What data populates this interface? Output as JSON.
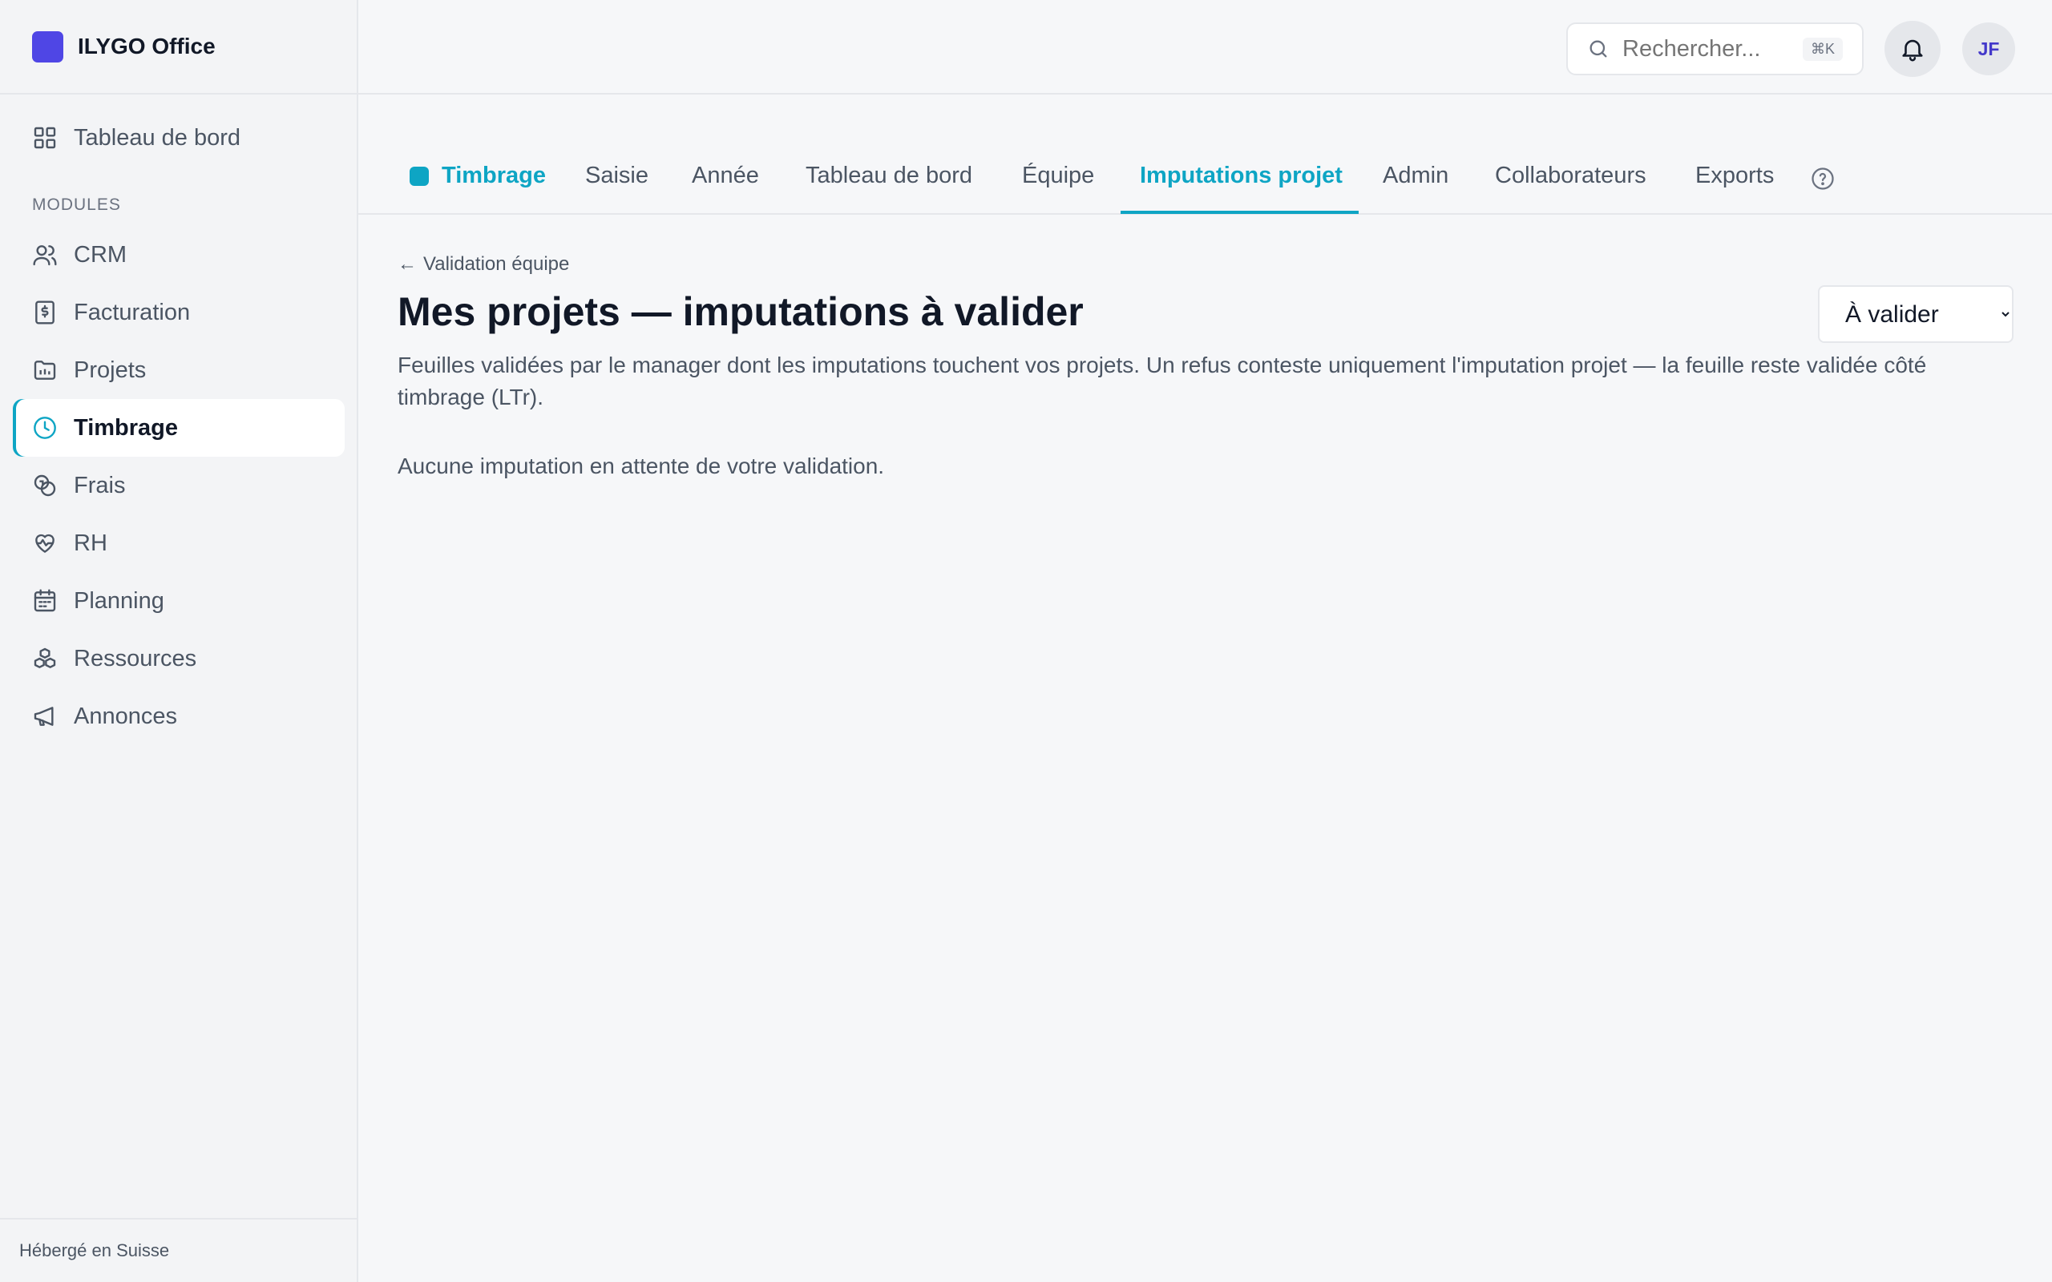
{
  "app": {
    "name": "ILYGO Office",
    "brand_color": "#4f46e5",
    "accent_color": "#0ea5c4"
  },
  "sidebar": {
    "dashboard": {
      "label": "Tableau de bord",
      "icon": "grid-icon"
    },
    "section_label": "MODULES",
    "items": [
      {
        "label": "CRM",
        "icon": "users-icon"
      },
      {
        "label": "Facturation",
        "icon": "receipt-icon"
      },
      {
        "label": "Projets",
        "icon": "folder-icon"
      },
      {
        "label": "Timbrage",
        "icon": "clock-icon",
        "active": true
      },
      {
        "label": "Frais",
        "icon": "coins-icon"
      },
      {
        "label": "RH",
        "icon": "heart-pulse-icon"
      },
      {
        "label": "Planning",
        "icon": "calendar-icon"
      },
      {
        "label": "Ressources",
        "icon": "boxes-icon"
      },
      {
        "label": "Annonces",
        "icon": "megaphone-icon"
      }
    ],
    "footer": "Hébergé en Suisse"
  },
  "topbar": {
    "search_placeholder": "Rechercher...",
    "search_shortcut": "⌘K",
    "avatar_initials": "JF"
  },
  "tabs": {
    "module": "Timbrage",
    "items": [
      "Saisie",
      "Année",
      "Tableau de bord",
      "Équipe",
      "Imputations projet",
      "Admin",
      "Collaborateurs",
      "Exports"
    ],
    "active": "Imputations projet"
  },
  "content": {
    "back_link": "Validation équipe",
    "title": "Mes projets — imputations à valider",
    "filter_selected": "À valider",
    "description": "Feuilles validées par le manager dont les imputations touchent vos projets. Un refus conteste uniquement l'imputation projet — la feuille reste validée côté timbrage (LTr).",
    "empty_message": "Aucune imputation en attente de votre validation."
  }
}
